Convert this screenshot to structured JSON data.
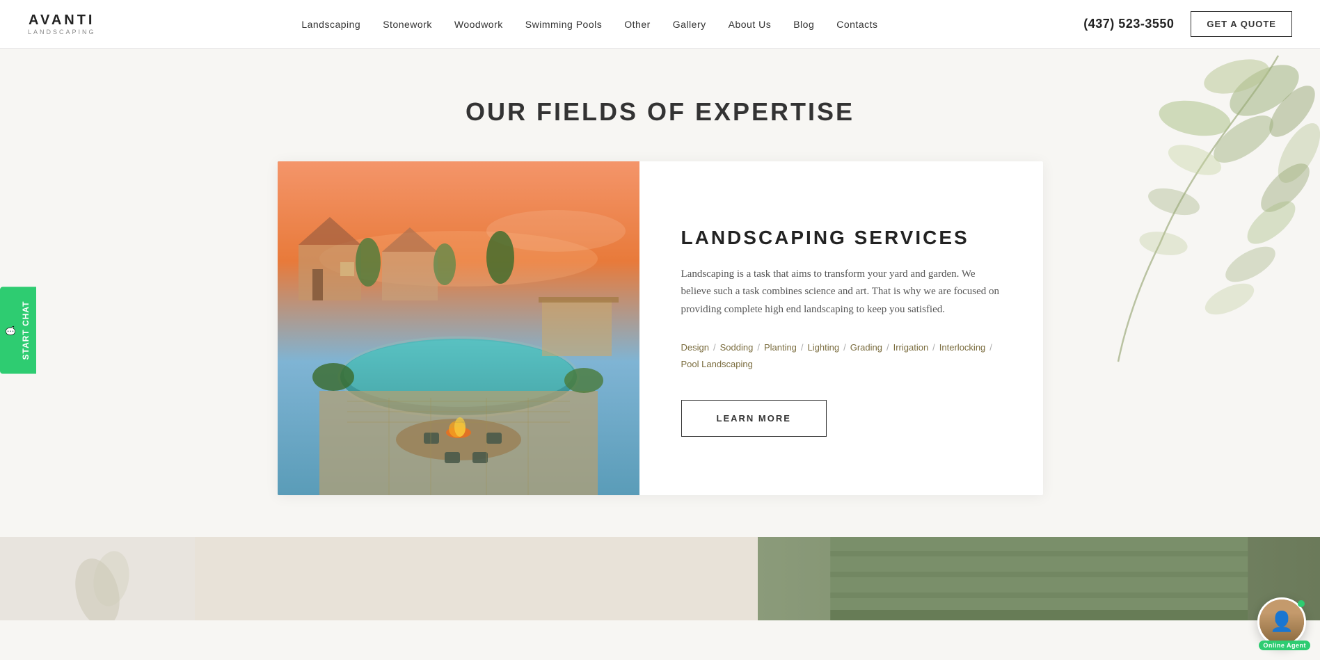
{
  "header": {
    "logo_top": "AVANTI",
    "logo_sub": "LANDSCAPING",
    "phone": "(437) 523-3550",
    "get_quote_label": "GET A QUOTE",
    "nav": [
      {
        "label": "Landscaping",
        "href": "#"
      },
      {
        "label": "Stonework",
        "href": "#"
      },
      {
        "label": "Woodwork",
        "href": "#"
      },
      {
        "label": "Swimming Pools",
        "href": "#"
      },
      {
        "label": "Other",
        "href": "#"
      },
      {
        "label": "Gallery",
        "href": "#"
      },
      {
        "label": "About Us",
        "href": "#"
      },
      {
        "label": "Blog",
        "href": "#"
      },
      {
        "label": "Contacts",
        "href": "#"
      }
    ]
  },
  "expertise_section": {
    "title": "OUR FIELDS OF EXPERTISE",
    "service": {
      "name": "LANDSCAPING SERVICES",
      "description": "Landscaping is a task that aims to transform your yard and garden. We believe such a task combines science and art. That is why we are focused on providing complete high end landscaping to keep you satisfied.",
      "tags": [
        "Design",
        "Sodding",
        "Planting",
        "Lighting",
        "Grading",
        "Irrigation",
        "Interlocking",
        "Pool Landscaping"
      ],
      "learn_more_label": "LEARN MORE"
    }
  },
  "chat": {
    "label": "START CHAT"
  },
  "agent": {
    "online_label": "Online Agent"
  },
  "colors": {
    "accent_green": "#6b7a5c",
    "tag_color": "#7a6c3e",
    "chat_green": "#2ecc71"
  }
}
